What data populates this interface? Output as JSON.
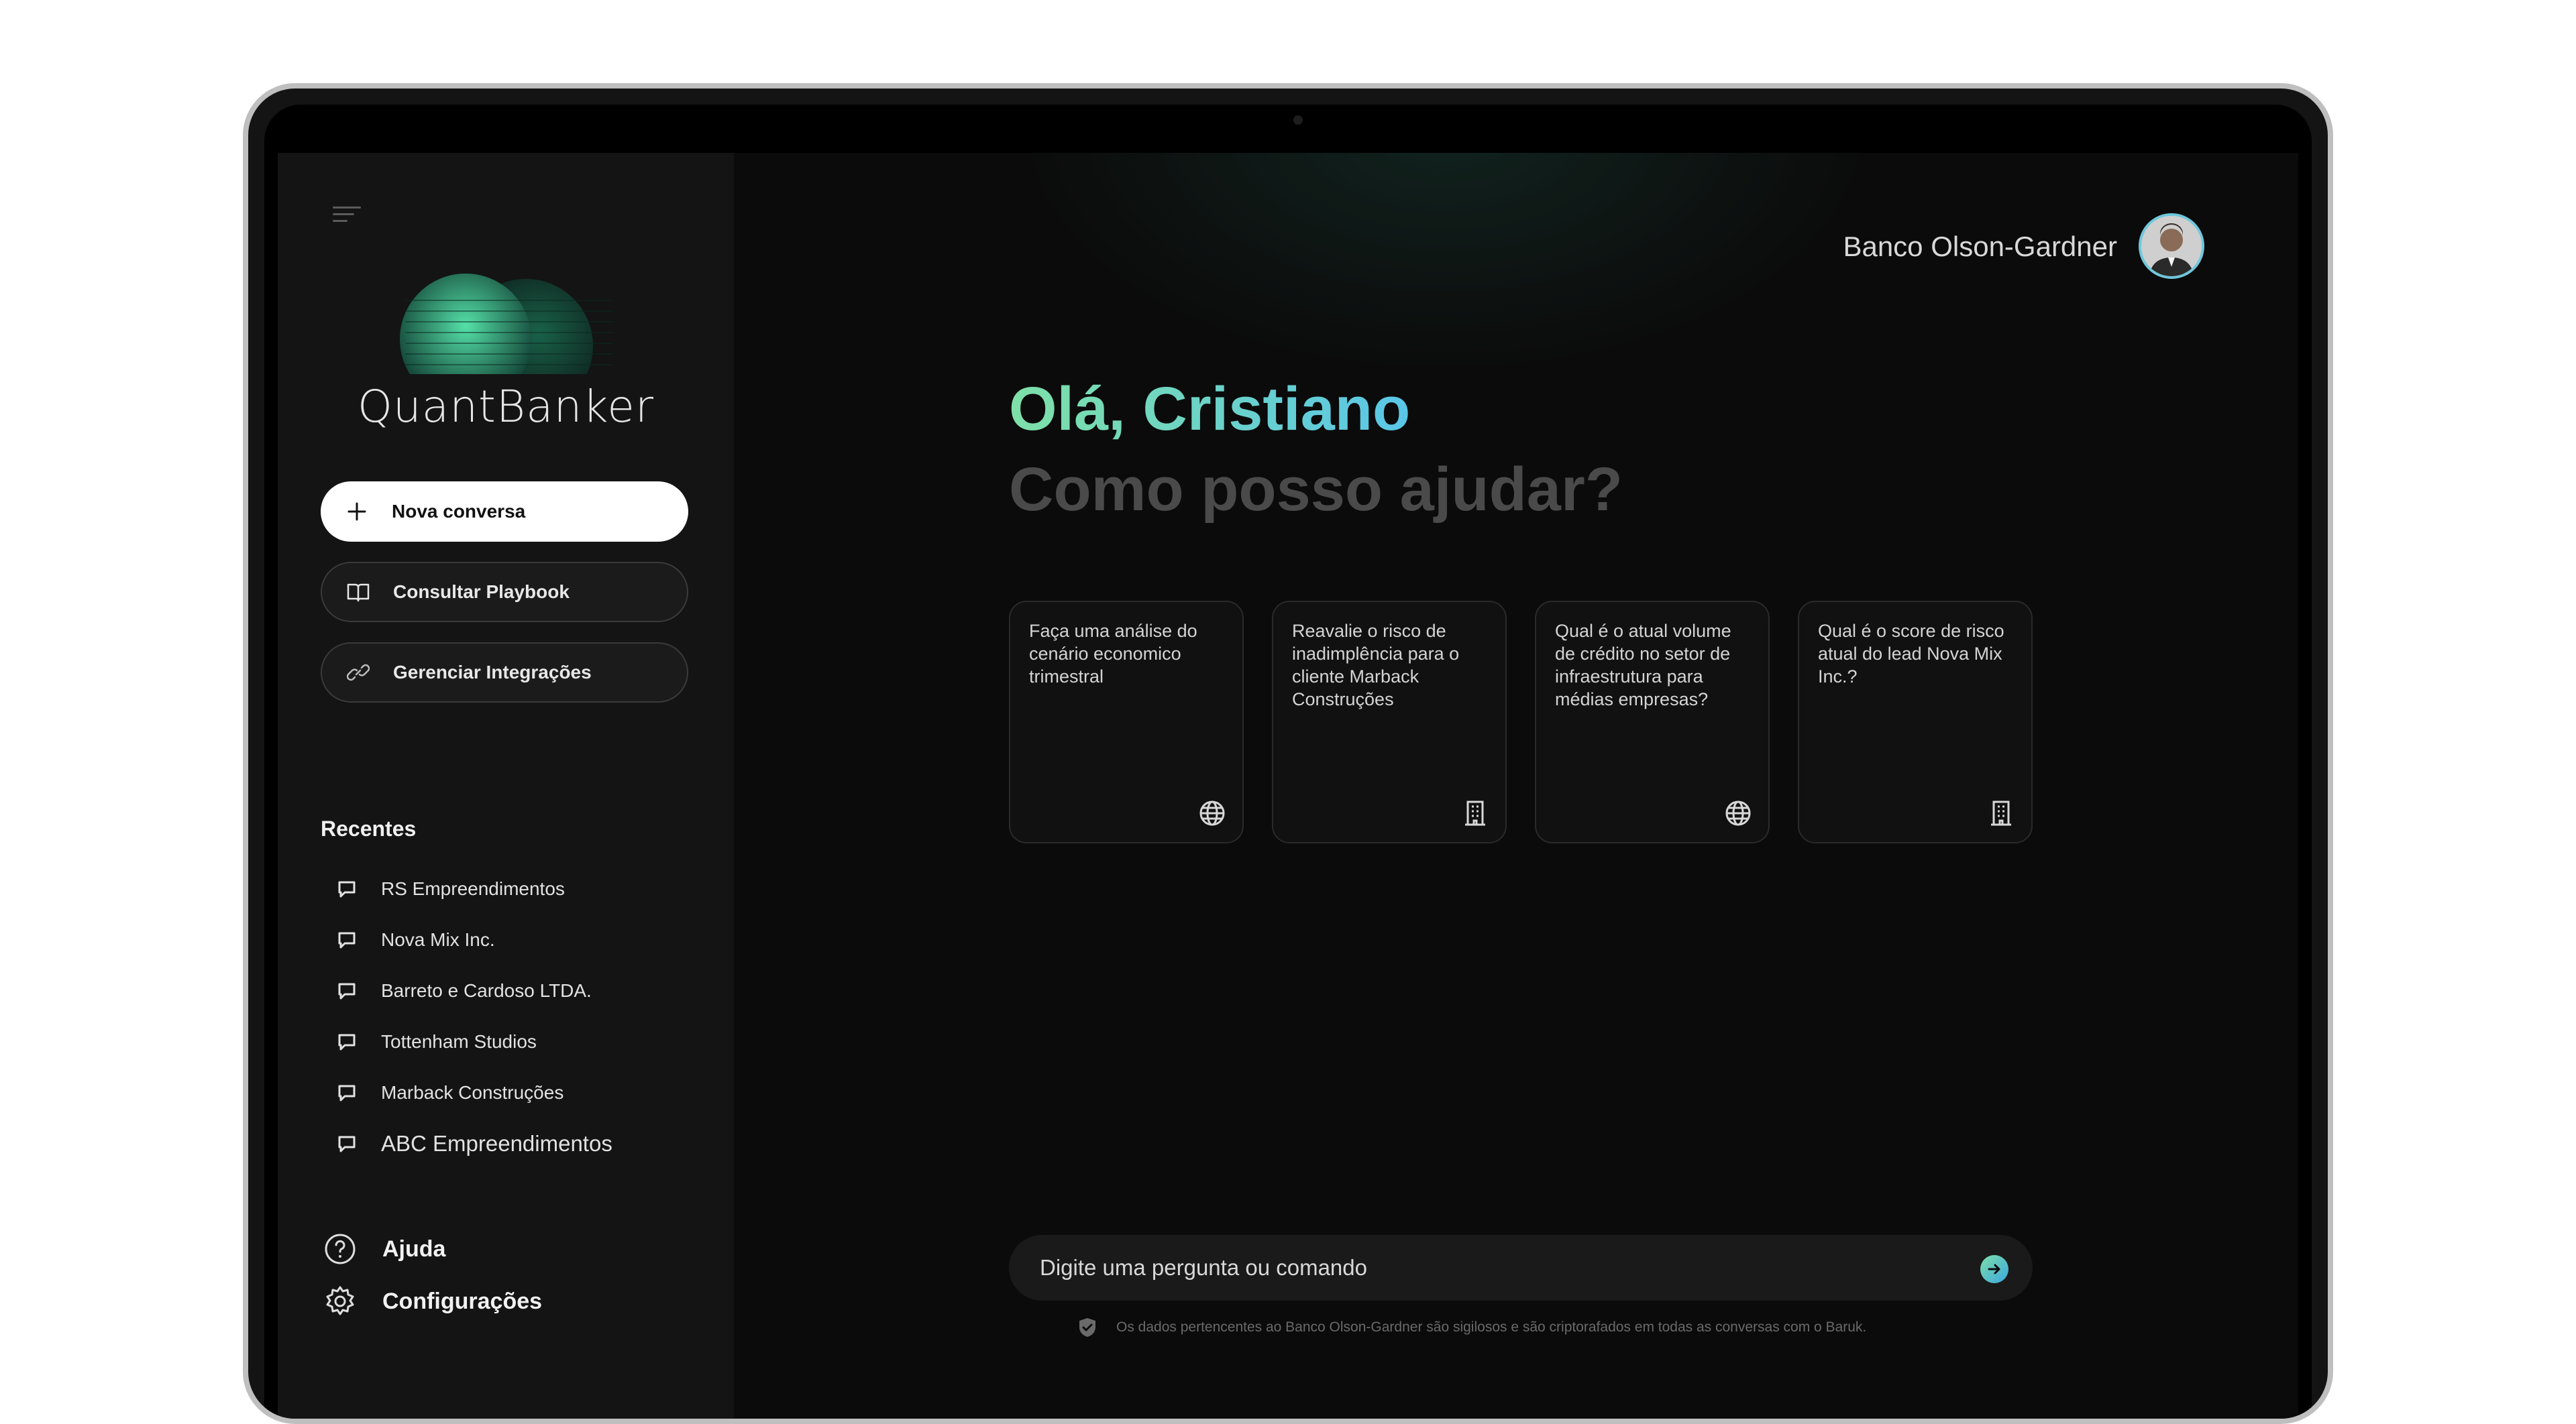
{
  "app": {
    "name": "QuantBanker"
  },
  "header": {
    "bank_name": "Banco Olson-Gardner"
  },
  "sidebar": {
    "new_chat_label": "Nova conversa",
    "playbook_label": "Consultar Playbook",
    "integrations_label": "Gerenciar Integrações",
    "recent_title": "Recentes",
    "recent": [
      "RS Empreendimentos",
      "Nova Mix Inc.",
      "Barreto e Cardoso LTDA.",
      "Tottenham Studios",
      "Marback Construções",
      "ABC  Empreendimentos"
    ],
    "help_label": "Ajuda",
    "settings_label": "Configurações"
  },
  "main": {
    "greeting": "Olá, Cristiano",
    "subgreeting": "Como posso ajudar?",
    "cards": [
      {
        "text": "Faça uma análise do cenário economico trimestral",
        "icon": "globe-icon"
      },
      {
        "text": "Reavalie o risco de inadimplência para o cliente Marback Construções",
        "icon": "building-icon"
      },
      {
        "text": "Qual é o atual volume de crédito no setor de infraestrutura para médias empresas?",
        "icon": "globe-icon"
      },
      {
        "text": "Qual é o score de risco atual do lead Nova Mix Inc.?",
        "icon": "building-icon"
      }
    ],
    "input_placeholder": "Digite uma pergunta ou comando",
    "disclaimer": "Os dados pertencentes ao Banco Olson-Gardner são sigilosos e são criptorafados em todas as conversas com o Baruk."
  },
  "colors": {
    "accent_green": "#7ee0a7",
    "accent_blue": "#5ac6e8",
    "sidebar_bg": "#141414",
    "main_bg": "#0b0b0b"
  }
}
